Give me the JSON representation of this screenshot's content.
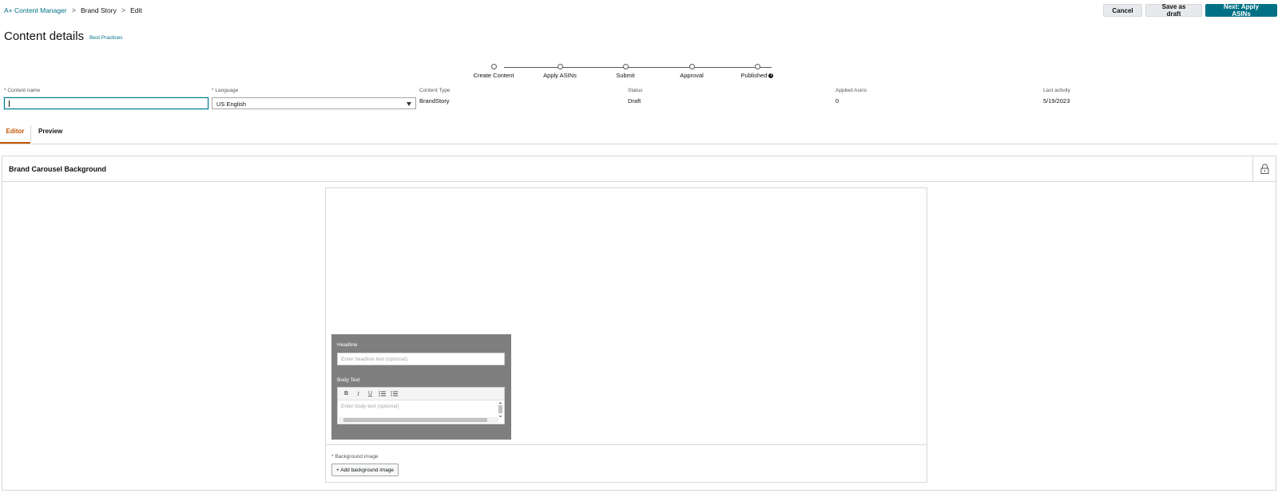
{
  "breadcrumb": {
    "items": [
      "A+ Content Manager",
      "Brand Story",
      "Edit"
    ],
    "separator": ">"
  },
  "actions": {
    "cancel_label": "Cancel",
    "save_draft_label": "Save as draft",
    "next_label": "Next: Apply ASINs"
  },
  "header": {
    "title": "Content details",
    "best_practices_link": "Best Practices"
  },
  "stepper": {
    "steps": [
      "Create Content",
      "Apply ASINs",
      "Submit",
      "Approval",
      "Published"
    ],
    "info_icon": "i"
  },
  "fields": {
    "content_name": {
      "label": "Content name",
      "required_mark": "*",
      "value": ""
    },
    "language": {
      "label": "Language",
      "required_mark": "*",
      "value": "US English"
    },
    "content_type": {
      "label": "Content Type",
      "value": "BrandStory"
    },
    "status": {
      "label": "Status",
      "value": "Draft"
    },
    "applied_asins": {
      "label": "Applied Asins",
      "value": "0"
    },
    "last_activity": {
      "label": "Last activity",
      "value": "5/19/2023"
    }
  },
  "tabs": {
    "editor_label": "Editor",
    "preview_label": "Preview",
    "active": "Editor"
  },
  "module": {
    "title": "Brand Carousel Background",
    "headline_label": "Headline",
    "headline_placeholder": "Enter headline text (optional)",
    "body_label": "Body Text",
    "body_placeholder": "Enter body text (optional)",
    "toolbar": {
      "bold": "B",
      "italic": "I",
      "underline": "U"
    },
    "background_image_label": "Background image",
    "background_required_mark": "*",
    "add_background_label": "+ Add background image"
  },
  "colors": {
    "link": "#007185",
    "primary_button": "#007185",
    "active_tab": "#c45500",
    "overlay": "#7f7f7f"
  }
}
